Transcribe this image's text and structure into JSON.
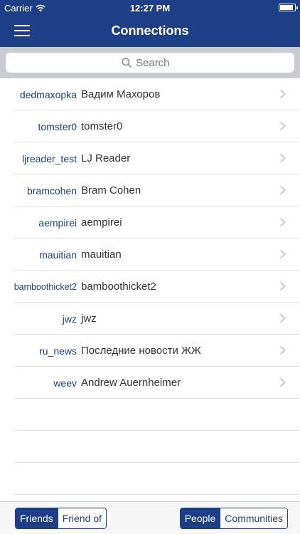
{
  "status_bar": {
    "carrier": "Carrier",
    "time": "12:27 PM"
  },
  "nav": {
    "title": "Connections",
    "menu_icon": "hamburger-menu-icon"
  },
  "search": {
    "placeholder": "Search",
    "value": ""
  },
  "connections": [
    {
      "username": "dedmaxopka",
      "display_name": "Вадим Махоров"
    },
    {
      "username": "tomster0",
      "display_name": "tomster0"
    },
    {
      "username": "ljreader_test",
      "display_name": "LJ Reader"
    },
    {
      "username": "bramcohen",
      "display_name": "Bram Cohen"
    },
    {
      "username": "aempirei",
      "display_name": "aempirei"
    },
    {
      "username": "mauitian",
      "display_name": "mauitian"
    },
    {
      "username": "bamboothicket2",
      "display_name": "bamboothicket2"
    },
    {
      "username": "jwz",
      "display_name": "jwz"
    },
    {
      "username": "ru_news",
      "display_name": "Последние новости ЖЖ"
    },
    {
      "username": "weev",
      "display_name": "Andrew Auernheimer"
    }
  ],
  "toolbar": {
    "relation_segment": {
      "options": [
        "Friends",
        "Friend of"
      ],
      "selected": "Friends"
    },
    "type_segment": {
      "options": [
        "People",
        "Communities"
      ],
      "selected": "People"
    }
  },
  "colors": {
    "brand": "#1d3f87",
    "search_bg": "#c9cdd3",
    "separator": "#e0e0e5"
  }
}
